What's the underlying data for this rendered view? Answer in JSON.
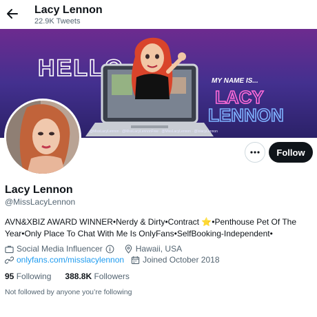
{
  "header": {
    "title": "Lacy Lennon",
    "tweet_count": "22.9K Tweets"
  },
  "banner": {
    "hello": "HELLO",
    "my_name_is": "MY NAME IS...",
    "name_line1": "LACY",
    "name_line2": "LENNON",
    "handles_strip": "@MissLacyLennon  ·  @MissLacyLennonFree  ·  @MissLacyLennon  ·  @lolacyLennon"
  },
  "actions": {
    "follow_label": "Follow"
  },
  "profile": {
    "name": "Lacy Lennon",
    "handle": "@MissLacyLennon",
    "bio_part1": "AVN&XBIZ AWARD WINNER•Nerdy & Dirty•Contract ",
    "bio_star": "⭐",
    "bio_part2": "•Penthouse Pet Of The Year•Only Place To Chat With Me Is OnlyFans•SelfBooking-Independent•",
    "category": "Social Media Influencer",
    "location": "Hawaii, USA",
    "website": "onlyfans.com/misslacylennon",
    "joined": "Joined October 2018",
    "following_count": "95",
    "following_label": "Following",
    "followers_count": "388.8K",
    "followers_label": "Followers",
    "not_followed": "Not followed by anyone you’re following"
  },
  "colors": {
    "accent_link": "#1d9bf0",
    "follow_bg": "#0f1419",
    "secondary_text": "#536471",
    "neon_pink": "#ff6bd8",
    "neon_blue": "#7fb2ff"
  }
}
